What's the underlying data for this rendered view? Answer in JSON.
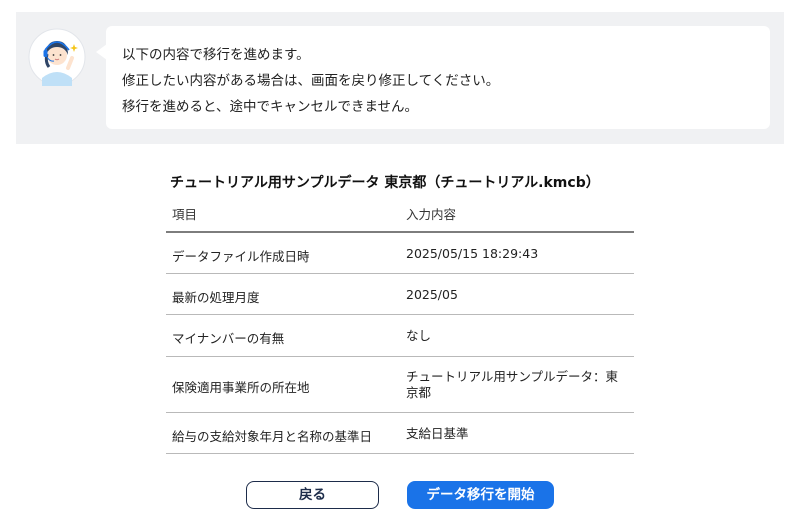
{
  "notice": {
    "lines": [
      "以下の内容で移行を進めます。",
      "修正したい内容がある場合は、画面を戻り修正してください。",
      "移行を進めると、途中でキャンセルできません。"
    ],
    "avatar_icon": "support-operator-icon"
  },
  "summary": {
    "title": "チュートリアル用サンプルデータ 東京都（チュートリアル.kmcb）",
    "headers": {
      "item": "項目",
      "value": "入力内容"
    },
    "rows": [
      {
        "label": "データファイル作成日時",
        "value": "2025/05/15 18:29:43"
      },
      {
        "label": "最新の処理月度",
        "value": "2025/05"
      },
      {
        "label": "マイナンバーの有無",
        "value": "なし"
      },
      {
        "label": "保険適用事業所の所在地",
        "value": "チュートリアル用サンプルデータ：東京都"
      },
      {
        "label": "給与の支給対象年月と名称の基準日",
        "value": "支給日基準"
      }
    ]
  },
  "actions": {
    "back_label": "戻る",
    "start_label": "データ移行を開始"
  },
  "colors": {
    "primary": "#1a73e8",
    "back_border": "#1d2c4a",
    "notice_bg": "#f0f1f3"
  }
}
